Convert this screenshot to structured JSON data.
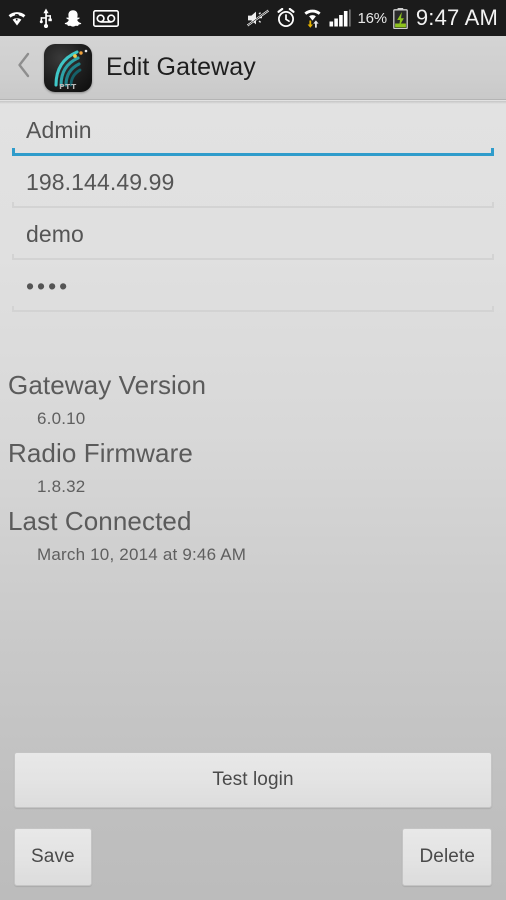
{
  "status_bar": {
    "icons_left": [
      "wifi-question-icon",
      "usb-icon",
      "snapchat-icon",
      "voicemail-icon"
    ],
    "icons_right": [
      "mute-vibrate-icon",
      "alarm-clock-icon",
      "wifi-transfer-icon",
      "cell-signal-icon"
    ],
    "battery_percent": "16%",
    "battery_icon": "battery-charging-icon",
    "clock": "9:47 AM"
  },
  "action_bar": {
    "back_icon": "back-chevron-icon",
    "app_icon": "ptt-app-icon",
    "app_icon_label": "PTT",
    "title": "Edit Gateway"
  },
  "form": {
    "fields": [
      {
        "name": "gateway-name",
        "value": "Admin",
        "focused": true,
        "masked": false
      },
      {
        "name": "gateway-address",
        "value": "198.144.49.99",
        "focused": false,
        "masked": false
      },
      {
        "name": "username",
        "value": "demo",
        "focused": false,
        "masked": false
      },
      {
        "name": "password",
        "value": "••••",
        "focused": false,
        "masked": true
      }
    ]
  },
  "info": {
    "rows": [
      {
        "label": "Gateway Version",
        "value": "6.0.10"
      },
      {
        "label": "Radio Firmware",
        "value": "1.8.32"
      },
      {
        "label": "Last Connected",
        "value": "March 10, 2014 at 9:46 AM"
      }
    ]
  },
  "buttons": {
    "test_login": "Test login",
    "save": "Save",
    "delete": "Delete"
  },
  "colors": {
    "accent_blue": "#2f9ccb",
    "status_bar_bg": "#1b1b1b",
    "action_bar_bg": "#cfcfcf",
    "text_primary": "#1e1e1e",
    "text_secondary": "#5b5b5b",
    "battery_green": "#8ec21f"
  }
}
